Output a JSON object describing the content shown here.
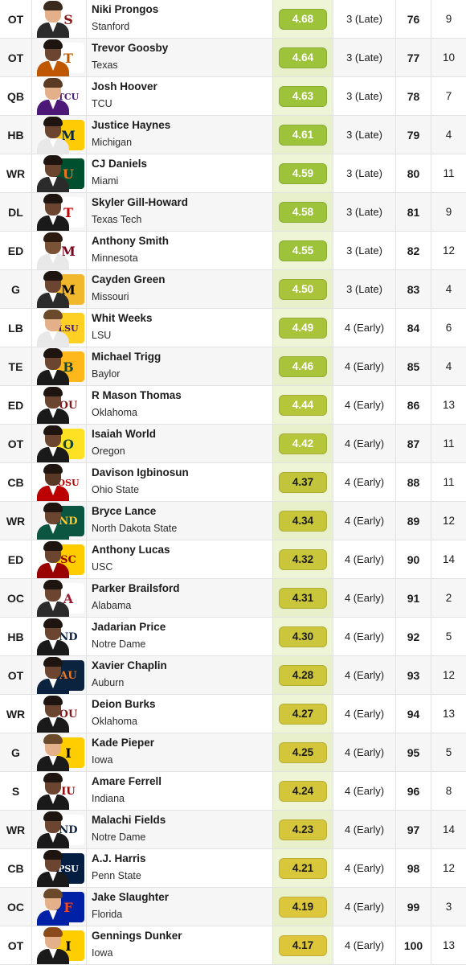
{
  "rows": [
    {
      "pos": "OT",
      "name": "Niki Prongos",
      "school": "Stanford",
      "grade": "4.68",
      "round": "3 (Late)",
      "pick": "76",
      "dpos": "9",
      "logo": "S",
      "logo_color": "#8c1515",
      "logo_bg": "#ffffff",
      "skin": "#e3b08a",
      "hair": "#3a2a1e",
      "shirt": "#2b2b2b",
      "pill_color": "#9cc33a"
    },
    {
      "pos": "OT",
      "name": "Trevor Goosby",
      "school": "Texas",
      "grade": "4.64",
      "round": "3 (Late)",
      "pick": "77",
      "dpos": "10",
      "logo": "T",
      "logo_color": "#bf5700",
      "logo_bg": "#ffffff",
      "skin": "#6b4530",
      "hair": "#1e1410",
      "shirt": "#bf5700",
      "pill_color": "#9cc33a"
    },
    {
      "pos": "QB",
      "name": "Josh Hoover",
      "school": "TCU",
      "grade": "4.63",
      "round": "3 (Late)",
      "pick": "78",
      "dpos": "7",
      "logo": "TCU",
      "logo_color": "#4d1979",
      "logo_bg": "#ffffff",
      "skin": "#e3b08a",
      "hair": "#5a3a22",
      "shirt": "#4d1979",
      "pill_color": "#9cc33a"
    },
    {
      "pos": "HB",
      "name": "Justice Haynes",
      "school": "Michigan",
      "grade": "4.61",
      "round": "3 (Late)",
      "pick": "79",
      "dpos": "4",
      "logo": "M",
      "logo_color": "#00274c",
      "logo_bg": "#ffcb05",
      "skin": "#6b4530",
      "hair": "#1e1410",
      "shirt": "#e8e8e8",
      "pill_color": "#9cc33a"
    },
    {
      "pos": "WR",
      "name": "CJ Daniels",
      "school": "Miami",
      "grade": "4.59",
      "round": "3 (Late)",
      "pick": "80",
      "dpos": "11",
      "logo": "U",
      "logo_color": "#f47321",
      "logo_bg": "#005030",
      "skin": "#6b4530",
      "hair": "#1e1410",
      "shirt": "#2b2b2b",
      "pill_color": "#9cc33a"
    },
    {
      "pos": "DL",
      "name": "Skyler Gill-Howard",
      "school": "Texas Tech",
      "grade": "4.58",
      "round": "3 (Late)",
      "pick": "81",
      "dpos": "9",
      "logo": "T",
      "logo_color": "#cc0000",
      "logo_bg": "#ffffff",
      "skin": "#6b4530",
      "hair": "#1e1410",
      "shirt": "#1a1a1a",
      "pill_color": "#9cc33a"
    },
    {
      "pos": "ED",
      "name": "Anthony Smith",
      "school": "Minnesota",
      "grade": "4.55",
      "round": "3 (Late)",
      "pick": "82",
      "dpos": "12",
      "logo": "M",
      "logo_color": "#7a0019",
      "logo_bg": "#ffffff",
      "skin": "#7a5236",
      "hair": "#2a1a10",
      "shirt": "#e8e8e8",
      "pill_color": "#9cc33a"
    },
    {
      "pos": "G",
      "name": "Cayden Green",
      "school": "Missouri",
      "grade": "4.50",
      "round": "3 (Late)",
      "pick": "83",
      "dpos": "4",
      "logo": "M",
      "logo_color": "#000000",
      "logo_bg": "#f1b82d",
      "skin": "#6b4530",
      "hair": "#1e1410",
      "shirt": "#2b2b2b",
      "pill_color": "#a9c43a"
    },
    {
      "pos": "LB",
      "name": "Whit Weeks",
      "school": "LSU",
      "grade": "4.49",
      "round": "4 (Early)",
      "pick": "84",
      "dpos": "6",
      "logo": "LSU",
      "logo_color": "#461d7c",
      "logo_bg": "#fdd023",
      "skin": "#e3b08a",
      "hair": "#6a4a2a",
      "shirt": "#e8e8e8",
      "pill_color": "#a9c43a"
    },
    {
      "pos": "TE",
      "name": "Michael Trigg",
      "school": "Baylor",
      "grade": "4.46",
      "round": "4 (Early)",
      "pick": "85",
      "dpos": "4",
      "logo": "B",
      "logo_color": "#154734",
      "logo_bg": "#ffb81c",
      "skin": "#6b4530",
      "hair": "#1e1410",
      "shirt": "#1a1a1a",
      "pill_color": "#a9c43a"
    },
    {
      "pos": "ED",
      "name": "R Mason Thomas",
      "school": "Oklahoma",
      "grade": "4.44",
      "round": "4 (Early)",
      "pick": "86",
      "dpos": "13",
      "logo": "OU",
      "logo_color": "#841617",
      "logo_bg": "#ffffff",
      "skin": "#6b4530",
      "hair": "#1e1410",
      "shirt": "#1a1a1a",
      "pill_color": "#b5c63a"
    },
    {
      "pos": "OT",
      "name": "Isaiah World",
      "school": "Oregon",
      "grade": "4.42",
      "round": "4 (Early)",
      "pick": "87",
      "dpos": "11",
      "logo": "O",
      "logo_color": "#154733",
      "logo_bg": "#fee123",
      "skin": "#6b4530",
      "hair": "#1e1410",
      "shirt": "#1a1a1a",
      "pill_color": "#b5c63a"
    },
    {
      "pos": "CB",
      "name": "Davison Igbinosun",
      "school": "Ohio State",
      "grade": "4.37",
      "round": "4 (Early)",
      "pick": "88",
      "dpos": "11",
      "logo": "OSU",
      "logo_color": "#bb0000",
      "logo_bg": "#ffffff",
      "skin": "#5a3826",
      "hair": "#1e1410",
      "shirt": "#bb0000",
      "pill_color": "#c2c53b"
    },
    {
      "pos": "WR",
      "name": "Bryce Lance",
      "school": "North Dakota State",
      "grade": "4.34",
      "round": "4 (Early)",
      "pick": "89",
      "dpos": "12",
      "logo": "ND",
      "logo_color": "#ffc72c",
      "logo_bg": "#0a5640",
      "skin": "#6b4530",
      "hair": "#1e1410",
      "shirt": "#0a5640",
      "pill_color": "#c7c63b"
    },
    {
      "pos": "ED",
      "name": "Anthony Lucas",
      "school": "USC",
      "grade": "4.32",
      "round": "4 (Early)",
      "pick": "90",
      "dpos": "14",
      "logo": "SC",
      "logo_color": "#990000",
      "logo_bg": "#ffcc00",
      "skin": "#6b4530",
      "hair": "#1e1410",
      "shirt": "#990000",
      "pill_color": "#c9c63b"
    },
    {
      "pos": "OC",
      "name": "Parker Brailsford",
      "school": "Alabama",
      "grade": "4.31",
      "round": "4 (Early)",
      "pick": "91",
      "dpos": "2",
      "logo": "A",
      "logo_color": "#9e1b32",
      "logo_bg": "#ffffff",
      "skin": "#6b4530",
      "hair": "#1e1410",
      "shirt": "#2b2b2b",
      "pill_color": "#c9c63b"
    },
    {
      "pos": "HB",
      "name": "Jadarian Price",
      "school": "Notre Dame",
      "grade": "4.30",
      "round": "4 (Early)",
      "pick": "92",
      "dpos": "5",
      "logo": "ND",
      "logo_color": "#0c2340",
      "logo_bg": "#ffffff",
      "skin": "#6b4530",
      "hair": "#1e1410",
      "shirt": "#1a1a1a",
      "pill_color": "#cbc63b"
    },
    {
      "pos": "OT",
      "name": "Xavier Chaplin",
      "school": "Auburn",
      "grade": "4.28",
      "round": "4 (Early)",
      "pick": "93",
      "dpos": "12",
      "logo": "AU",
      "logo_color": "#e87722",
      "logo_bg": "#0c2340",
      "skin": "#6b4530",
      "hair": "#1e1410",
      "shirt": "#0c2340",
      "pill_color": "#cec63b"
    },
    {
      "pos": "WR",
      "name": "Deion Burks",
      "school": "Oklahoma",
      "grade": "4.27",
      "round": "4 (Early)",
      "pick": "94",
      "dpos": "13",
      "logo": "OU",
      "logo_color": "#841617",
      "logo_bg": "#ffffff",
      "skin": "#6b4530",
      "hair": "#1e1410",
      "shirt": "#1a1a1a",
      "pill_color": "#d0c63b"
    },
    {
      "pos": "G",
      "name": "Kade Pieper",
      "school": "Iowa",
      "grade": "4.25",
      "round": "4 (Early)",
      "pick": "95",
      "dpos": "5",
      "logo": "I",
      "logo_color": "#000000",
      "logo_bg": "#ffcd00",
      "skin": "#e3b08a",
      "hair": "#6a4a2a",
      "shirt": "#1a1a1a",
      "pill_color": "#d3c63b"
    },
    {
      "pos": "S",
      "name": "Amare Ferrell",
      "school": "Indiana",
      "grade": "4.24",
      "round": "4 (Early)",
      "pick": "96",
      "dpos": "8",
      "logo": "IU",
      "logo_color": "#990000",
      "logo_bg": "#ffffff",
      "skin": "#6b4530",
      "hair": "#1e1410",
      "shirt": "#1a1a1a",
      "pill_color": "#d3c63b"
    },
    {
      "pos": "WR",
      "name": "Malachi Fields",
      "school": "Notre Dame",
      "grade": "4.23",
      "round": "4 (Early)",
      "pick": "97",
      "dpos": "14",
      "logo": "ND",
      "logo_color": "#0c2340",
      "logo_bg": "#ffffff",
      "skin": "#6b4530",
      "hair": "#1e1410",
      "shirt": "#1a1a1a",
      "pill_color": "#d5c63b"
    },
    {
      "pos": "CB",
      "name": "A.J. Harris",
      "school": "Penn State",
      "grade": "4.21",
      "round": "4 (Early)",
      "pick": "98",
      "dpos": "12",
      "logo": "PSU",
      "logo_color": "#ffffff",
      "logo_bg": "#041e42",
      "skin": "#6b4530",
      "hair": "#1e1410",
      "shirt": "#1a1a1a",
      "pill_color": "#d8c63b"
    },
    {
      "pos": "OC",
      "name": "Jake Slaughter",
      "school": "Florida",
      "grade": "4.19",
      "round": "4 (Early)",
      "pick": "99",
      "dpos": "3",
      "logo": "F",
      "logo_color": "#fa4616",
      "logo_bg": "#0021a5",
      "skin": "#e3b08a",
      "hair": "#6a4a2a",
      "shirt": "#0021a5",
      "pill_color": "#dcc63b"
    },
    {
      "pos": "OT",
      "name": "Gennings Dunker",
      "school": "Iowa",
      "grade": "4.17",
      "round": "4 (Early)",
      "pick": "100",
      "dpos": "13",
      "logo": "I",
      "logo_color": "#000000",
      "logo_bg": "#ffcd00",
      "skin": "#e3b08a",
      "hair": "#8a4a1a",
      "shirt": "#1a1a1a",
      "pill_color": "#dec63b"
    }
  ]
}
